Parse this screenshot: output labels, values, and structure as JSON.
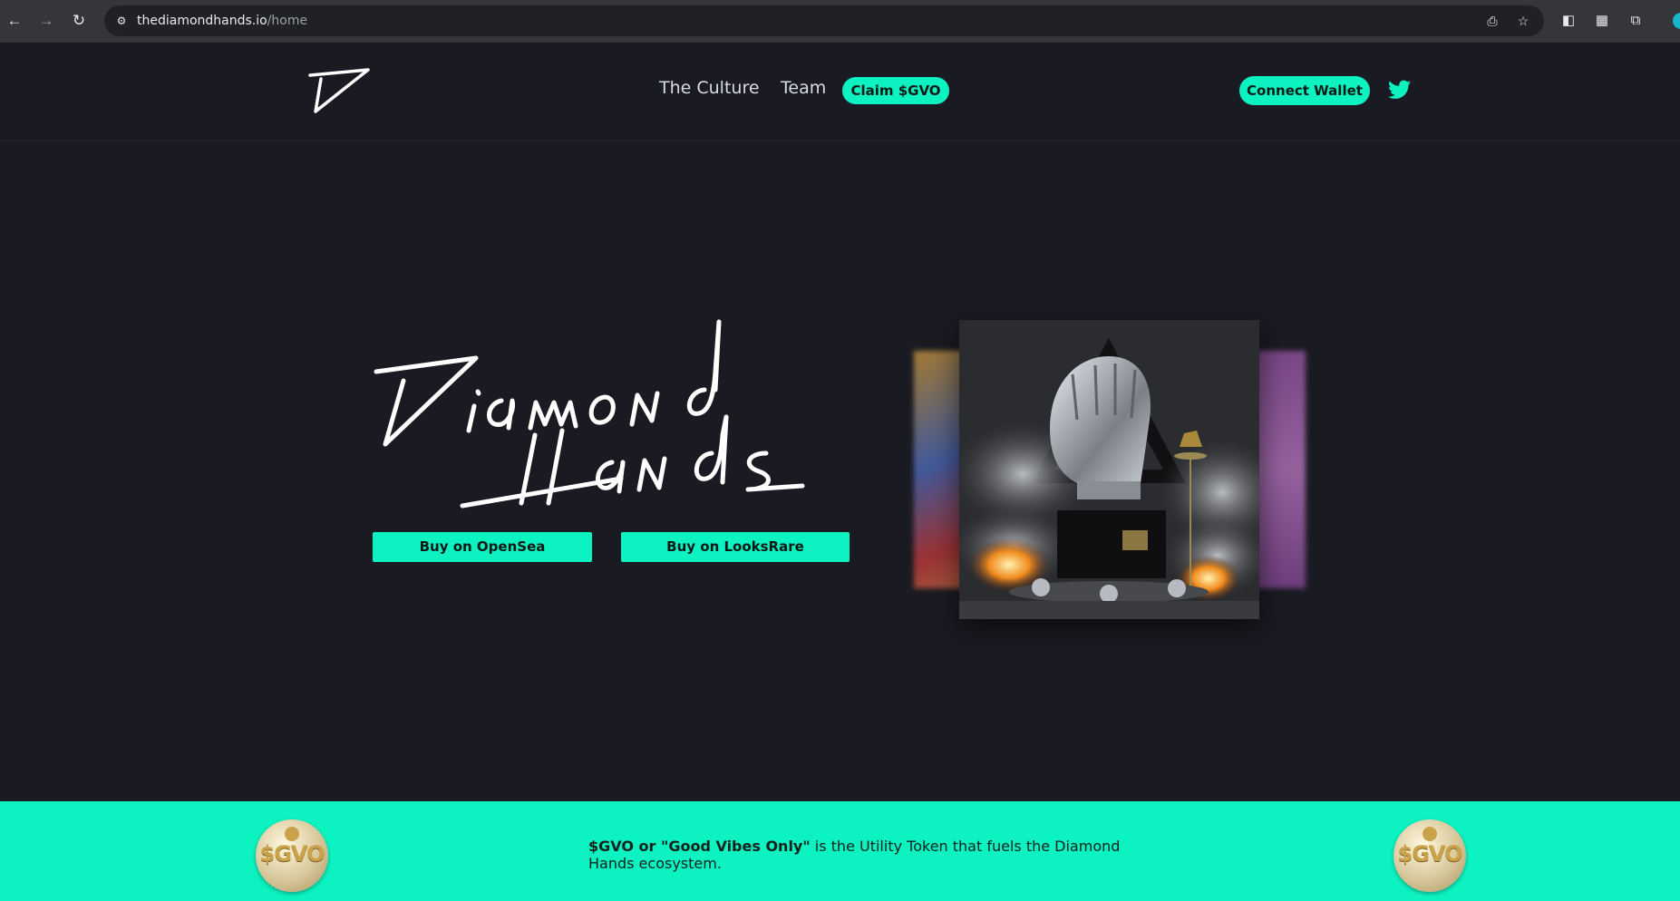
{
  "browser": {
    "url_host": "thediamondhands.io",
    "url_path": "/home",
    "back_icon": "arrow-left-icon",
    "forward_icon": "arrow-right-icon",
    "reload_icon": "reload-icon"
  },
  "header": {
    "nav": {
      "culture": "The Culture",
      "team": "Team",
      "claim": "Claim $GVO"
    },
    "connect_wallet": "Connect Wallet"
  },
  "hero": {
    "title_line1": "Diamond",
    "title_line2": "Hands",
    "buy_opensea": "Buy on OpenSea",
    "buy_looksrare": "Buy on LooksRare"
  },
  "band": {
    "coin_text": "$GVO",
    "lead_bold": "$GVO or \"Good Vibes Only\"",
    "text": " is the Utility Token that fuels the Diamond Hands ecosystem."
  },
  "colors": {
    "accent": "#0cf2c0",
    "background": "#1a1b22"
  }
}
